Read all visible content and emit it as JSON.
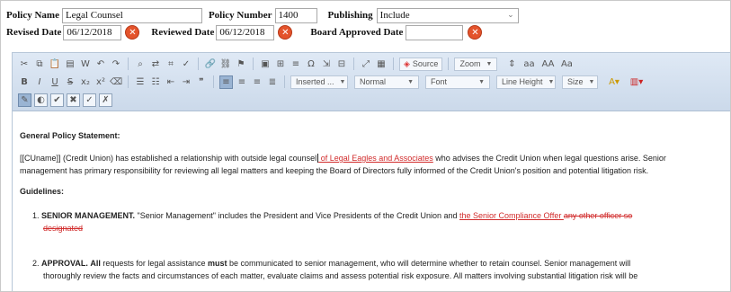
{
  "form": {
    "policy_name_label": "Policy Name",
    "policy_name_value": "Legal Counsel",
    "policy_number_label": "Policy Number",
    "policy_number_value": "1400",
    "publishing_label": "Publishing",
    "publishing_value": "Include",
    "revised_date_label": "Revised Date",
    "revised_date_value": "06/12/2018",
    "reviewed_date_label": "Reviewed Date",
    "reviewed_date_value": "06/12/2018",
    "board_approved_label": "Board Approved Date",
    "board_approved_value": "",
    "clear_glyph": "✕"
  },
  "toolbar": {
    "source_label": "Source",
    "zoom_label": "Zoom",
    "inserted_label": "Inserted ...",
    "format_label": "Normal",
    "font_label": "Font",
    "line_height_label": "Line Height",
    "size_label": "Size"
  },
  "document": {
    "heading": "General Policy Statement:",
    "para1_line1_a": "[[CUname]] (Credit Union) has established a relationship with outside legal counsel",
    "para1_line1_ins": " of Legal Eagles and Associates",
    "para1_line1_b": " who advises the Credit Union when legal questions arise. Senior",
    "para1_line2": "management has primary responsibility for reviewing all legal matters and keeping the Board of Directors fully informed of the Credit Union's position and potential litigation risk.",
    "guidelines_heading": "Guidelines:",
    "item1_num": "1.",
    "item1_bold": "SENIOR MANAGEMENT.",
    "item1_text": " \"Senior Management\" includes the President and Vice Presidents of the Credit Union and ",
    "item1_ins": " the Senior Compliance Offer ",
    "item1_del_a": "any other officer so",
    "item1_del_b": "designated",
    "item2_num": "2.",
    "item2_bold": "APPROVAL.",
    "item2_bold2": "All",
    "item2_text_a": " requests for legal assistance ",
    "item2_must": "must",
    "item2_text_b": " be communicated to senior management, who will determine whether to retain counsel. Senior management will",
    "item2_line2": "thoroughly review the facts and circumstances of each matter, evaluate claims and assess potential risk exposure. All matters involving substantial litigation risk will be"
  },
  "colors": {
    "clear_button": "#e4532b",
    "tracked_change": "#d12b2b",
    "toolbar_bg": "#d6e2f0"
  }
}
